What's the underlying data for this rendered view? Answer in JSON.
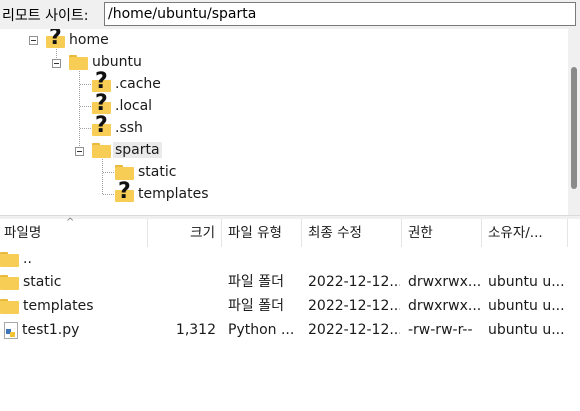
{
  "remote_site": {
    "label": "리모트 사이트:",
    "path": "/home/ubuntu/sparta"
  },
  "tree": {
    "nodes": [
      {
        "label": "home",
        "icon": "unknown-folder-icon"
      },
      {
        "label": "ubuntu",
        "icon": "folder-icon"
      },
      {
        "label": ".cache",
        "icon": "unknown-folder-icon"
      },
      {
        "label": ".local",
        "icon": "unknown-folder-icon"
      },
      {
        "label": ".ssh",
        "icon": "unknown-folder-icon"
      },
      {
        "label": "sparta",
        "icon": "folder-icon",
        "selected": true
      },
      {
        "label": "static",
        "icon": "folder-icon"
      },
      {
        "label": "templates",
        "icon": "unknown-folder-icon"
      }
    ]
  },
  "list": {
    "columns": [
      "파일명",
      "크기",
      "파일 유형",
      "최종 수정",
      "권한",
      "소유자/..."
    ],
    "rows": [
      {
        "name": "..",
        "size": "",
        "type": "",
        "modified": "",
        "perms": "",
        "owner": "",
        "icon": "folder-icon"
      },
      {
        "name": "static",
        "size": "",
        "type": "파일 폴더",
        "modified": "2022-12-12...",
        "perms": "drwxrwx...",
        "owner": "ubuntu u...",
        "icon": "folder-icon"
      },
      {
        "name": "templates",
        "size": "",
        "type": "파일 폴더",
        "modified": "2022-12-12...",
        "perms": "drwxrwx...",
        "owner": "ubuntu u...",
        "icon": "folder-icon"
      },
      {
        "name": "test1.py",
        "size": "1,312",
        "type": "Python ...",
        "modified": "2022-12-12...",
        "perms": "-rw-rw-r--",
        "owner": "ubuntu u...",
        "icon": "python-file-icon"
      }
    ]
  },
  "colors": {
    "folder": "#f7cd55",
    "selection": "#eaeaea",
    "scroll_thumb": "#8a8a8a"
  }
}
